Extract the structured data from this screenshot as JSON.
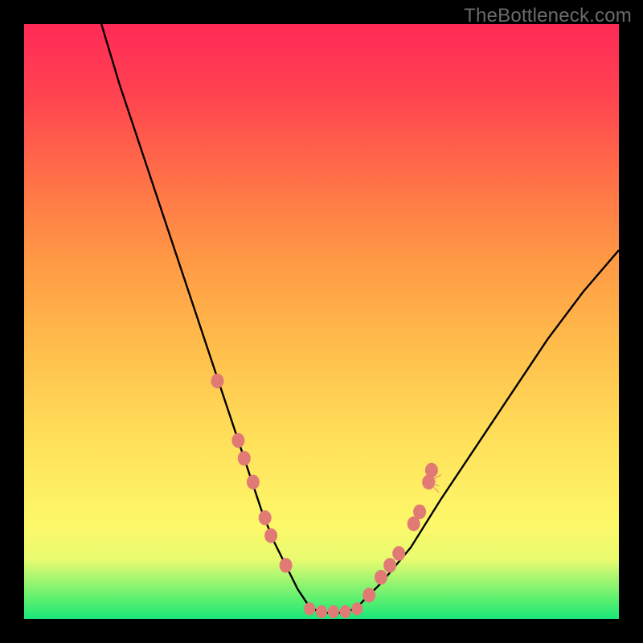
{
  "watermark": "TheBottleneck.com",
  "colors": {
    "dot": "#e17a75",
    "curve": "#000000",
    "frame": "#000000"
  },
  "chart_data": {
    "type": "line",
    "title": "",
    "xlabel": "",
    "ylabel": "",
    "xlim": [
      0,
      100
    ],
    "ylim": [
      0,
      100
    ],
    "grid": false,
    "annotations": [
      "TheBottleneck.com"
    ],
    "series": [
      {
        "name": "curve-left",
        "x": [
          13,
          16,
          20,
          24,
          28,
          32,
          36,
          38,
          40,
          42,
          44,
          46,
          48
        ],
        "values": [
          100,
          90,
          78,
          66,
          54,
          42,
          30,
          24,
          18,
          13,
          9,
          5,
          2
        ]
      },
      {
        "name": "curve-bottom",
        "x": [
          48,
          50,
          52,
          54,
          56
        ],
        "values": [
          2,
          1,
          1,
          1,
          2
        ]
      },
      {
        "name": "curve-right",
        "x": [
          56,
          60,
          65,
          70,
          76,
          82,
          88,
          94,
          100
        ],
        "values": [
          2,
          6,
          12,
          20,
          29,
          38,
          47,
          55,
          62
        ]
      }
    ],
    "points_left": [
      {
        "x": 32.5,
        "y": 40
      },
      {
        "x": 36,
        "y": 30
      },
      {
        "x": 37,
        "y": 27
      },
      {
        "x": 38.5,
        "y": 23
      },
      {
        "x": 40.5,
        "y": 17
      },
      {
        "x": 41.5,
        "y": 14
      },
      {
        "x": 44,
        "y": 9
      }
    ],
    "points_bottom": [
      {
        "x": 48,
        "y": 1.7
      },
      {
        "x": 50,
        "y": 1.2
      },
      {
        "x": 52,
        "y": 1.2
      },
      {
        "x": 54,
        "y": 1.2
      },
      {
        "x": 56,
        "y": 1.7
      }
    ],
    "points_right": [
      {
        "x": 58,
        "y": 4
      },
      {
        "x": 60,
        "y": 7
      },
      {
        "x": 61.5,
        "y": 9
      },
      {
        "x": 63,
        "y": 11
      },
      {
        "x": 65.5,
        "y": 16
      },
      {
        "x": 66.5,
        "y": 18
      },
      {
        "x": 68,
        "y": 23
      },
      {
        "x": 68.5,
        "y": 25
      }
    ],
    "spark_at": {
      "x": 68,
      "y": 23
    }
  }
}
